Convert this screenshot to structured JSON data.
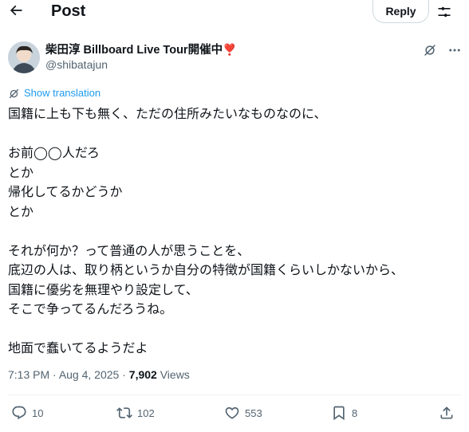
{
  "header": {
    "title": "Post",
    "reply_label": "Reply"
  },
  "author": {
    "display_name": "柴田淳 Billboard Live Tour開催中",
    "heart": "❣️",
    "handle": "@shibatajun"
  },
  "translate": {
    "label": "Show translation"
  },
  "tweet": {
    "lines": [
      "国籍に上も下も無く、ただの住所みたいなものなのに、",
      "",
      "お前◯◯人だろ",
      "とか",
      "帰化してるかどうか",
      "とか",
      "",
      "それが何か？って普通の人が思うことを、",
      "底辺の人は、取り柄というか自分の特徴が国籍くらいしかないから、",
      "国籍に優劣を無理やり設定して、",
      "そこで争ってるんだろうね。",
      "",
      "地面で蠢いてるようだよ"
    ]
  },
  "meta": {
    "time": "7:13 PM",
    "date": "Aug 4, 2025",
    "views_count": "7,902",
    "views_label": "Views"
  },
  "actions": {
    "replies": "10",
    "reposts": "102",
    "likes": "553",
    "bookmarks": "8"
  },
  "colors": {
    "text": "#0f1419",
    "secondary": "#536471",
    "link": "#1d9bf0",
    "border": "#cfd9de",
    "divider": "#eff3f4",
    "heart": "#e0245e"
  }
}
